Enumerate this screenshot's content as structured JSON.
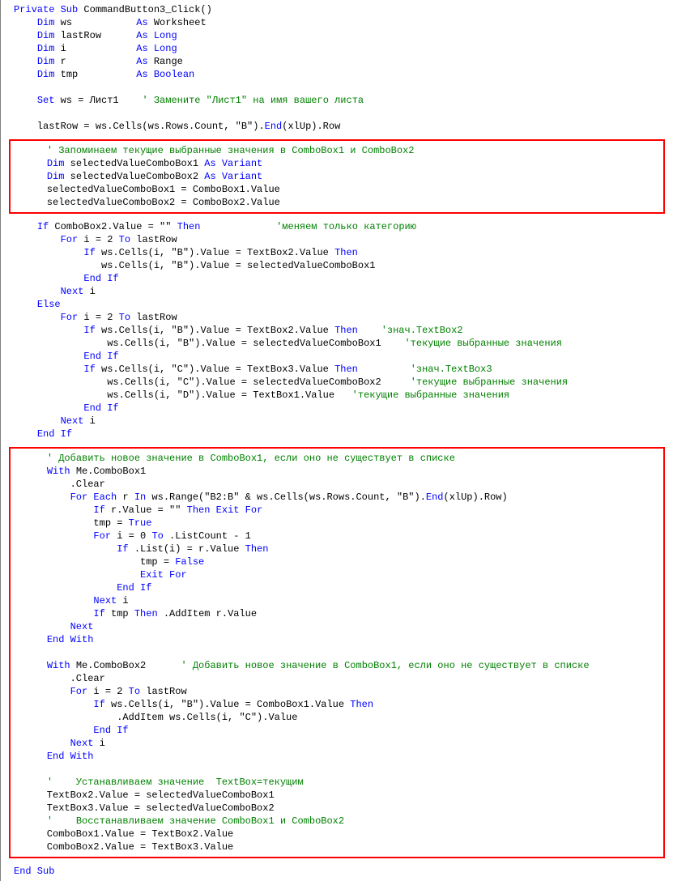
{
  "code": {
    "block1": {
      "l1_kw1": "Private Sub",
      "l1_tx1": " CommandButton3_Click()",
      "l2_kw1": "Dim",
      "l2_tx1": " ws           ",
      "l2_kw2": "As",
      "l2_tx2": " Worksheet",
      "l3_kw1": "Dim",
      "l3_tx1": " lastRow      ",
      "l3_kw2": "As Long",
      "l4_kw1": "Dim",
      "l4_tx1": " i            ",
      "l4_kw2": "As Long",
      "l5_kw1": "Dim",
      "l5_tx1": " r            ",
      "l5_kw2": "As",
      "l5_tx2": " Range",
      "l6_kw1": "Dim",
      "l6_tx1": " tmp          ",
      "l6_kw2": "As Boolean",
      "l8_kw1": "Set",
      "l8_tx1": " ws = Лист1    ",
      "l8_cm1": "' Замените \"Лист1\" на имя вашего листа",
      "l10_tx1": "    lastRow = ws.Cells(ws.Rows.Count, \"B\").",
      "l10_kw1": "End",
      "l10_tx2": "(xlUp).Row"
    },
    "block2": {
      "l1_cm1": "' Запоминаем текущие выбранные значения в ComboBox1 и ComboBox2",
      "l2_kw1": "Dim",
      "l2_tx1": " selectedValueComboBox1 ",
      "l2_kw2": "As Variant",
      "l3_kw1": "Dim",
      "l3_tx1": " selectedValueComboBox2 ",
      "l3_kw2": "As Variant",
      "l4_tx1": "    selectedValueComboBox1 = ComboBox1.Value",
      "l5_tx1": "    selectedValueComboBox2 = ComboBox2.Value"
    },
    "block3": {
      "l1_kw1": "If",
      "l1_tx1": " ComboBox2.Value = \"\" ",
      "l1_kw2": "Then",
      "l1_sp1": "             ",
      "l1_cm1": "'меняем только категорию",
      "l2_kw1": "For",
      "l2_tx1": " i = 2 ",
      "l2_kw2": "To",
      "l2_tx2": " lastRow",
      "l3_kw1": "If",
      "l3_tx1": " ws.Cells(i, \"B\").Value = TextBox2.Value ",
      "l3_kw2": "Then",
      "l4_tx1": "               ws.Cells(i, \"B\").Value = selectedValueComboBox1",
      "l5_kw1": "End If",
      "l6_kw1": "Next",
      "l6_tx1": " i",
      "l7_kw1": "Else",
      "l8_kw1": "For",
      "l8_tx1": " i = 2 ",
      "l8_kw2": "To",
      "l8_tx2": " lastRow",
      "l9_kw1": "If",
      "l9_tx1": " ws.Cells(i, \"B\").Value = TextBox2.Value ",
      "l9_kw2": "Then",
      "l9_sp1": "    ",
      "l9_cm1": "'знач.TextBox2",
      "l10_tx1": "                ws.Cells(i, \"B\").Value = selectedValueComboBox1    ",
      "l10_cm1": "'текущие выбранные значения",
      "l11_kw1": "End If",
      "l12_kw1": "If",
      "l12_tx1": " ws.Cells(i, \"C\").Value = TextBox3.Value ",
      "l12_kw2": "Then",
      "l12_sp1": "         ",
      "l12_cm1": "'знач.TextBox3",
      "l13_tx1": "                ws.Cells(i, \"C\").Value = selectedValueComboBox2     ",
      "l13_cm1": "'текущие выбранные значения",
      "l14_tx1": "                ws.Cells(i, \"D\").Value = TextBox1.Value   ",
      "l14_cm1": "'текущие выбранные значения",
      "l15_kw1": "End If",
      "l16_kw1": "Next",
      "l16_tx1": " i",
      "l17_kw1": "End If"
    },
    "block4": {
      "l1_cm1": "' Добавить новое значение в ComboBox1, если оно не существует в списке",
      "l2_kw1": "With",
      "l2_tx1": " Me.ComboBox1",
      "l3_tx1": "        .Clear",
      "l4_kw1": "For Each",
      "l4_tx1": " r ",
      "l4_kw2": "In",
      "l4_tx2": " ws.Range(\"B2:B\" & ws.Cells(ws.Rows.Count, \"B\").",
      "l4_kw3": "End",
      "l4_tx3": "(xlUp).Row)",
      "l5_kw1": "If",
      "l5_tx1": " r.Value = \"\" ",
      "l5_kw2": "Then Exit For",
      "l6_tx1": "            tmp = ",
      "l6_kw1": "True",
      "l7_kw1": "For",
      "l7_tx1": " i = 0 ",
      "l7_kw2": "To",
      "l7_tx2": " .ListCount - 1",
      "l8_kw1": "If",
      "l8_tx1": " .List(i) = r.Value ",
      "l8_kw2": "Then",
      "l9_tx1": "                    tmp = ",
      "l9_kw1": "False",
      "l10_kw1": "Exit For",
      "l11_kw1": "End If",
      "l12_kw1": "Next",
      "l12_tx1": " i",
      "l13_kw1": "If",
      "l13_tx1": " tmp ",
      "l13_kw2": "Then",
      "l13_tx2": " .AddItem r.Value",
      "l14_kw1": "Next",
      "l15_kw1": "End With",
      "l17_kw1": "With",
      "l17_tx1": " Me.ComboBox2      ",
      "l17_cm1": "' Добавить новое значение в ComboBox1, если оно не существует в списке",
      "l18_tx1": "        .Clear",
      "l19_kw1": "For",
      "l19_tx1": " i = 2 ",
      "l19_kw2": "To",
      "l19_tx2": " lastRow",
      "l20_kw1": "If",
      "l20_tx1": " ws.Cells(i, \"B\").Value = ComboBox1.Value ",
      "l20_kw2": "Then",
      "l21_tx1": "                .AddItem ws.Cells(i, \"C\").Value",
      "l22_kw1": "End If",
      "l23_kw1": "Next",
      "l23_tx1": " i",
      "l24_kw1": "End With",
      "l26_cm1": "'    Устанавливаем значение  TextBox=текущим",
      "l27_tx1": "    TextBox2.Value = selectedValueComboBox1",
      "l28_tx1": "    TextBox3.Value = selectedValueComboBox2",
      "l29_cm1": "'    Восстанавливаем значение ComboBox1 и ComboBox2",
      "l30_tx1": "    ComboBox1.Value = TextBox2.Value",
      "l31_tx1": "    ComboBox2.Value = TextBox3.Value"
    },
    "block5": {
      "l1_kw1": "End Sub"
    }
  }
}
